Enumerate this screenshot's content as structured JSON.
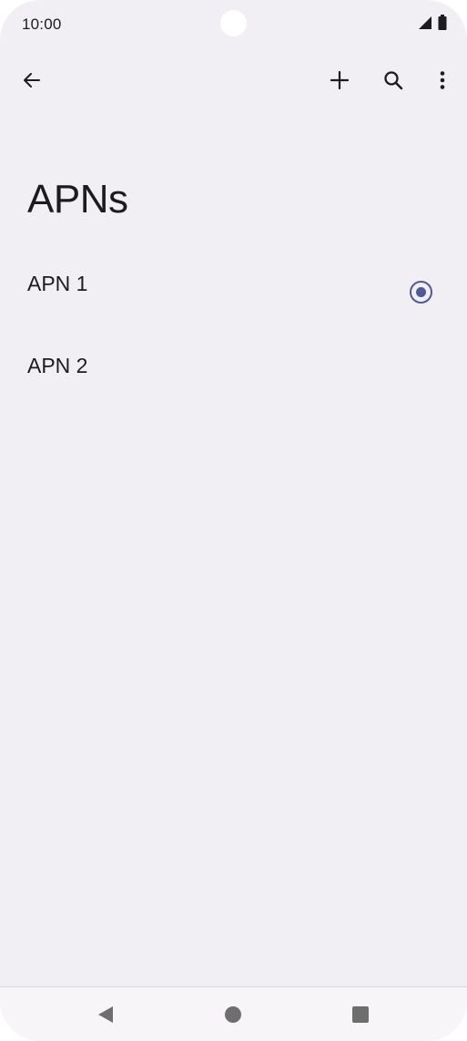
{
  "status_bar": {
    "time": "10:00",
    "icons": [
      "signal-icon",
      "battery-icon"
    ]
  },
  "app_bar": {
    "actions": [
      "back-arrow-icon",
      "add-icon",
      "search-icon",
      "more-vert-icon"
    ]
  },
  "page": {
    "title": "APNs"
  },
  "apn_list": {
    "items": [
      {
        "label": "APN 1",
        "selected": true
      },
      {
        "label": "APN 2",
        "selected": false
      }
    ]
  },
  "nav_bar": {
    "buttons": [
      "back-triangle-icon",
      "home-circle-icon",
      "recents-square-icon"
    ]
  },
  "colors": {
    "background": "#f1eff3",
    "accent": "#4f5b92",
    "text": "#1c1b1f",
    "nav_icon": "#6e6e6e"
  }
}
